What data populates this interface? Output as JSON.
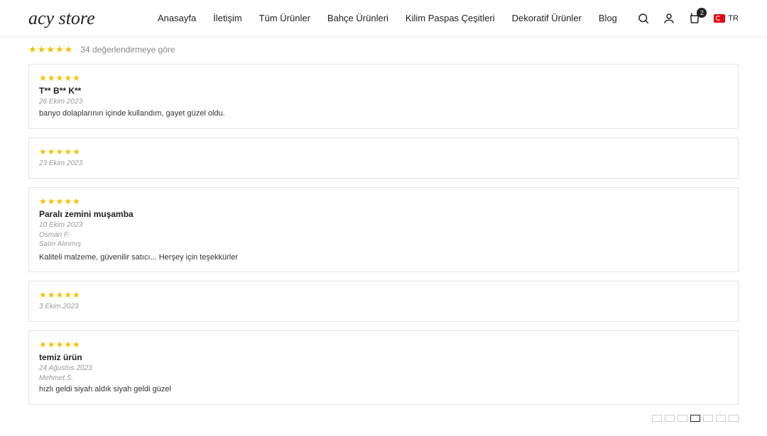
{
  "header": {
    "logo": "acy store",
    "nav": [
      "Anasayfa",
      "İletişim",
      "Tüm Ürünler",
      "Bahçe Ürünleri",
      "Kilim Paspas Çeşitleri",
      "Dekoratif Ürünler",
      "Blog"
    ],
    "cart_count": "2",
    "lang": "TR"
  },
  "summary": {
    "count_text": "34 değerlendirmeye göre"
  },
  "reviews": [
    {
      "title": "T** B** K**",
      "date": "26 Ekim 2023",
      "author": "",
      "verified": "",
      "text": "banyo dolaplarının içinde kullandım, gayet güzel oldu."
    },
    {
      "title": "",
      "date": "23 Ekim 2023",
      "author": "",
      "verified": "",
      "text": ""
    },
    {
      "title": "Paralı zemini muşamba",
      "date": "10 Ekim 2023",
      "author": "Osman F.",
      "verified": "Satın Alınmış",
      "text": "Kaliteli malzeme, güvenilir satıcı... Herşey için teşekkürler"
    },
    {
      "title": "",
      "date": "3 Ekim 2023",
      "author": "",
      "verified": "",
      "text": ""
    },
    {
      "title": "temiz ürün",
      "date": "24 Ağustos 2023",
      "author": "Mehmet S.",
      "verified": "",
      "text": "hızlı geldi siyah aldık siyah geldi güzel"
    }
  ]
}
